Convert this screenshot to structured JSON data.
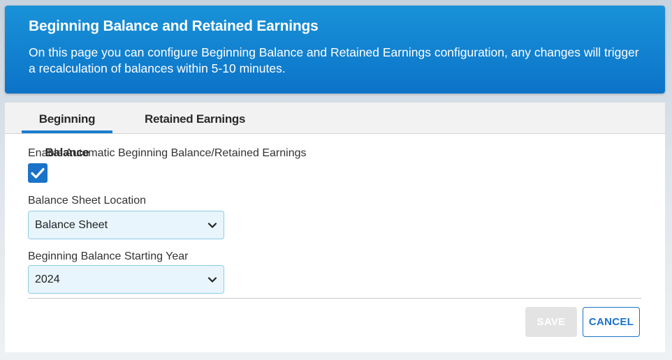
{
  "header": {
    "title": "Beginning Balance and Retained Earnings",
    "description": "On this page you can configure Beginning Balance and Retained Earnings configuration, any changes will trigger a recalculation of balances within 5-10 minutes."
  },
  "tabs": [
    {
      "label": "Beginning Balance",
      "active": true
    },
    {
      "label": "Retained Earnings",
      "active": false
    }
  ],
  "form": {
    "auto_label": "Enable Automatic Beginning Balance/Retained Earnings",
    "auto_checked": true,
    "location_label": "Balance Sheet Location",
    "location_value": "Balance Sheet",
    "year_label": "Beginning Balance Starting Year",
    "year_value": "2024"
  },
  "actions": {
    "save_label": "SAVE",
    "cancel_label": "CANCEL"
  },
  "colors": {
    "header_bg": "#0c73c8",
    "accent": "#1a73c8",
    "select_bg": "#e8f5fc",
    "save_disabled_bg": "#e3e3e3"
  },
  "icons": {
    "checkbox": "check-icon",
    "dropdown": "chevron-down-icon"
  }
}
